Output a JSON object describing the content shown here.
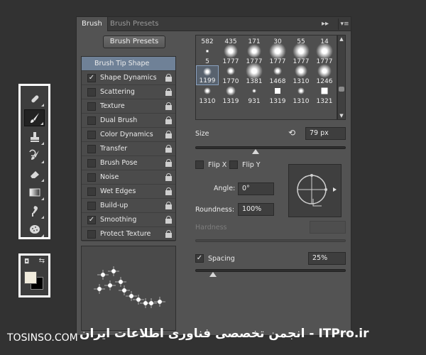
{
  "panel": {
    "tabs": [
      "Brush",
      "Brush Presets"
    ],
    "presets_button": "Brush Presets"
  },
  "options": [
    {
      "label": "Brush Tip Shape",
      "checked": null,
      "header": true
    },
    {
      "label": "Shape Dynamics",
      "checked": true
    },
    {
      "label": "Scattering",
      "checked": false
    },
    {
      "label": "Texture",
      "checked": false
    },
    {
      "label": "Dual Brush",
      "checked": false
    },
    {
      "label": "Color Dynamics",
      "checked": false
    },
    {
      "label": "Transfer",
      "checked": false
    },
    {
      "label": "Brush Pose",
      "checked": false
    },
    {
      "label": "Noise",
      "checked": false
    },
    {
      "label": "Wet Edges",
      "checked": false
    },
    {
      "label": "Build-up",
      "checked": false
    },
    {
      "label": "Smoothing",
      "checked": true
    },
    {
      "label": "Protect Texture",
      "checked": false
    }
  ],
  "brush_grid": {
    "rows": [
      [
        "582",
        "435",
        "171",
        "30",
        "55",
        "14"
      ],
      [
        "5",
        "1777",
        "1777",
        "1777",
        "1777",
        "1777"
      ],
      [
        "1199",
        "1770",
        "1381",
        "1468",
        "1310",
        "1246"
      ],
      [
        "1310",
        "1319",
        "931",
        "1319",
        "1310",
        "1321"
      ]
    ],
    "selected": "1199"
  },
  "controls": {
    "size_label": "Size",
    "size_value": "79 px",
    "flip_x": "Flip X",
    "flip_y": "Flip Y",
    "angle_label": "Angle:",
    "angle_value": "0°",
    "roundness_label": "Roundness:",
    "roundness_value": "100%",
    "hardness_label": "Hardness",
    "spacing_label": "Spacing",
    "spacing_value": "25%",
    "spacing_checked": true,
    "size_slider_fraction": 0.4,
    "spacing_slider_fraction": 0.12
  },
  "watermark": {
    "left": "TOSINSO.COM",
    "right": "انجمن تخصصی فناوری اطلاعات ایران - ITPro.ir"
  },
  "colors": {
    "foreground": "#f1ecdd",
    "background": "#000000",
    "selection": "#6f8197"
  },
  "toolbar_icons": [
    "healing-brush-icon",
    "brush-icon",
    "clone-stamp-icon",
    "history-brush-icon",
    "eraser-icon",
    "gradient-icon",
    "smudge-icon",
    "sponge-icon"
  ]
}
